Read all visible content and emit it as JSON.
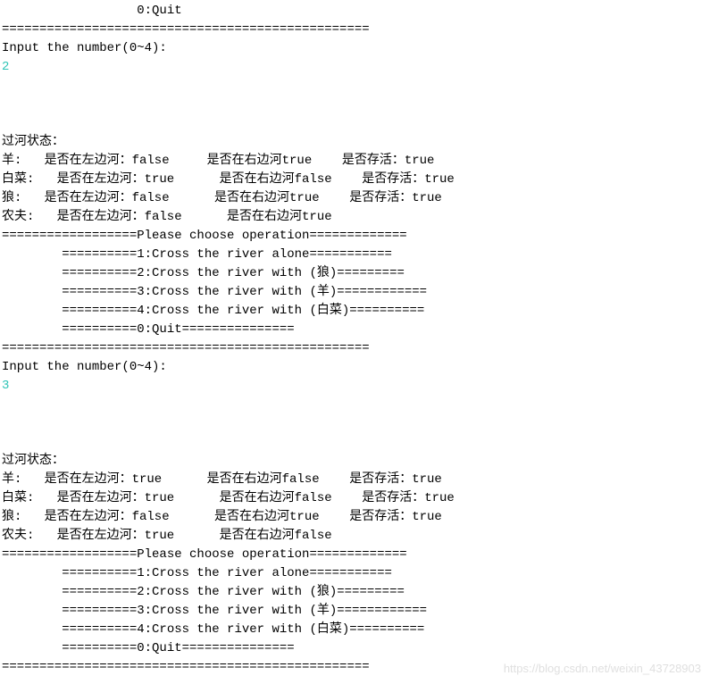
{
  "topSection": {
    "quitLine": "                  0:Quit",
    "separator": "=================================================",
    "prompt": "Input the number(0~4):",
    "input": "2"
  },
  "state1": {
    "title": "过河状态：",
    "sheep": "羊:   是否在左边河：false     是否在右边河true    是否存活：true",
    "cabbage": "白菜:   是否在左边河：true      是否在右边河false    是否存活：true",
    "wolf": "狼:   是否在左边河：false      是否在右边河true    是否存活：true",
    "farmer": "农夫:   是否在左边河：false      是否在右边河true"
  },
  "menu1": {
    "header": "==================Please choose operation=============",
    "opt1": "        ==========1:Cross the river alone===========",
    "opt2": "        ==========2:Cross the river with (狼)=========",
    "opt3": "        ==========3:Cross the river with (羊)============",
    "opt4": "        ==========4:Cross the river with (白菜)==========",
    "opt0": "        ==========0:Quit===============",
    "separator": "=================================================",
    "prompt": "Input the number(0~4):",
    "input": "3"
  },
  "state2": {
    "title": "过河状态：",
    "sheep": "羊:   是否在左边河：true      是否在右边河false    是否存活：true",
    "cabbage": "白菜:   是否在左边河：true      是否在右边河false    是否存活：true",
    "wolf": "狼:   是否在左边河：false      是否在右边河true    是否存活：true",
    "farmer": "农夫:   是否在左边河：true      是否在右边河false"
  },
  "menu2": {
    "header": "==================Please choose operation=============",
    "opt1": "        ==========1:Cross the river alone===========",
    "opt2": "        ==========2:Cross the river with (狼)=========",
    "opt3": "        ==========3:Cross the river with (羊)============",
    "opt4": "        ==========4:Cross the river with (白菜)==========",
    "opt0": "        ==========0:Quit===============",
    "separator": "================================================="
  },
  "watermark": "https://blog.csdn.net/weixin_43728903"
}
